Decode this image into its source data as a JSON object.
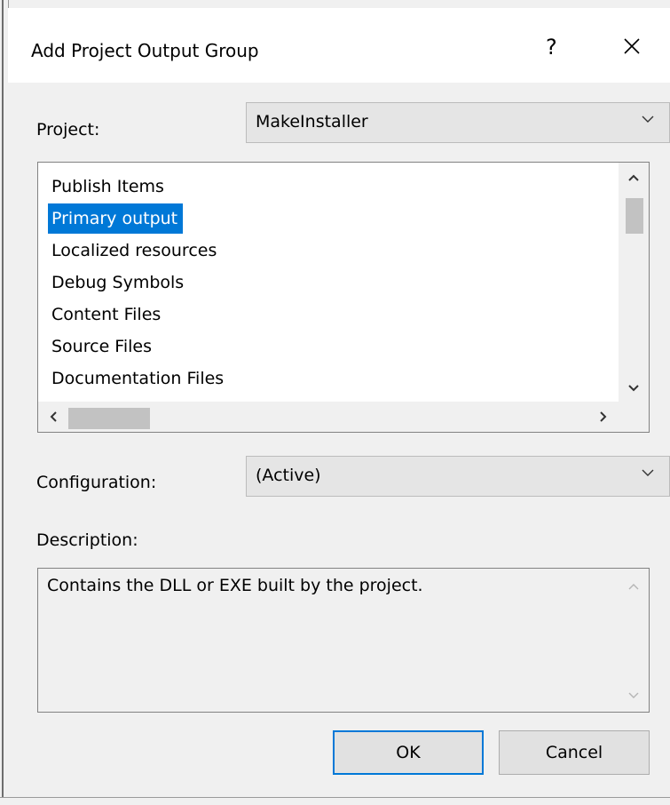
{
  "dialog": {
    "title": "Add Project Output Group",
    "help_label": "?",
    "close_label": "✕"
  },
  "project": {
    "label": "Project:",
    "selected": "MakeInstaller"
  },
  "output_list": {
    "items": [
      {
        "label": "Publish Items",
        "selected": false
      },
      {
        "label": "Primary output",
        "selected": true
      },
      {
        "label": "Localized resources",
        "selected": false
      },
      {
        "label": "Debug Symbols",
        "selected": false
      },
      {
        "label": "Content Files",
        "selected": false
      },
      {
        "label": "Source Files",
        "selected": false
      },
      {
        "label": "Documentation Files",
        "selected": false
      }
    ]
  },
  "configuration": {
    "label": "Configuration:",
    "selected": "(Active)"
  },
  "description": {
    "label": "Description:",
    "text": "Contains the DLL or EXE built by the project."
  },
  "buttons": {
    "ok_label": "OK",
    "cancel_label": "Cancel"
  },
  "colors": {
    "selection": "#0078d7",
    "dialog_bg": "#f0f0f0"
  }
}
